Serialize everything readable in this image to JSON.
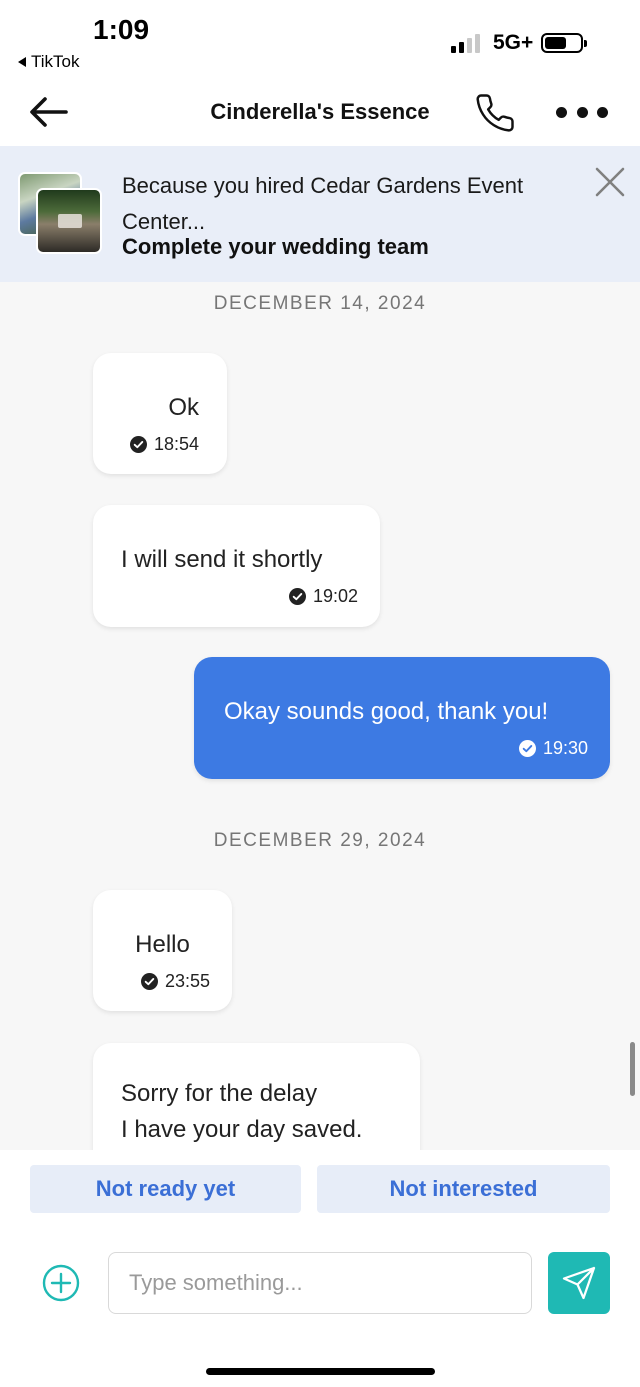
{
  "status_bar": {
    "time": "1:09",
    "back_app": "TikTok",
    "network": "5G+"
  },
  "header": {
    "title": "Cinderella's Essence"
  },
  "banner": {
    "line1": "Because you hired Cedar Gardens Event Center...",
    "line2": "Complete your wedding team"
  },
  "chat": {
    "date1": "DECEMBER 14, 2024",
    "date2": "DECEMBER 29, 2024",
    "messages": [
      {
        "text": "Ok",
        "time": "18:54",
        "from": "vendor"
      },
      {
        "text": "I will send it shortly",
        "time": "19:02",
        "from": "vendor"
      },
      {
        "text": "Okay sounds good, thank you!",
        "time": "19:30",
        "from": "me"
      },
      {
        "text": "Hello",
        "time": "23:55",
        "from": "vendor"
      },
      {
        "text": "Sorry for the delay\nI have your day saved.",
        "time": "",
        "from": "vendor"
      }
    ]
  },
  "quick_replies": {
    "not_ready": "Not ready yet",
    "not_interested": "Not interested"
  },
  "composer": {
    "placeholder": "Type something...",
    "value": ""
  },
  "colors": {
    "accent_blue": "#3d7ae3",
    "send_teal": "#1fb9b4",
    "banner_bg": "#e9eef8"
  },
  "icons": [
    "back-arrow-icon",
    "phone-icon",
    "more-dots-icon",
    "close-icon",
    "check-circle-icon",
    "plus-circle-icon",
    "send-paper-plane-icon"
  ]
}
